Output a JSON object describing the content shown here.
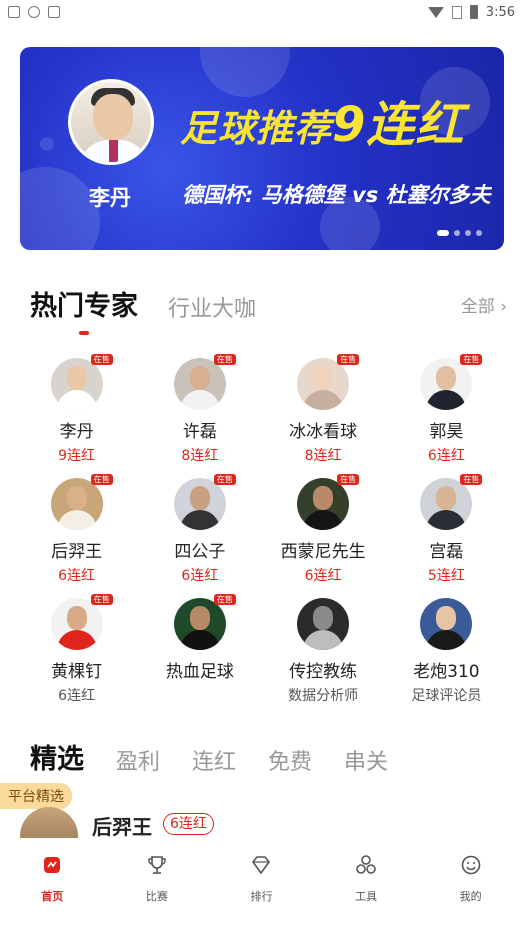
{
  "status_bar": {
    "time": "3:56"
  },
  "banner": {
    "person_name": "李丹",
    "title_prefix": "足球推荐",
    "title_highlight": "9连红",
    "subtitle": "德国杯: 马格德堡 vs 杜塞尔多夫",
    "page_count": 4,
    "active_page": 1
  },
  "hot_section": {
    "tabs": [
      {
        "label": "热门专家",
        "active": true
      },
      {
        "label": "行业大咖",
        "active": false
      }
    ],
    "all_link": "全部 ›",
    "experts": [
      {
        "name": "李丹",
        "sub": "9连红",
        "badge": "在售",
        "sub_color": "red",
        "avatar": {
          "bg": "#d8d3cc",
          "head": "#e9c8a8",
          "body": "#ffffff"
        }
      },
      {
        "name": "许磊",
        "sub": "8连红",
        "badge": "在售",
        "sub_color": "red",
        "avatar": {
          "bg": "#c9c2b8",
          "head": "#d7b090",
          "body": "#f2f2f2"
        }
      },
      {
        "name": "冰冰看球",
        "sub": "8连红",
        "badge": "在售",
        "sub_color": "red",
        "avatar": {
          "bg": "#e8d8cc",
          "head": "#f1d2bd",
          "body": "#c8b0a0"
        }
      },
      {
        "name": "郭昊",
        "sub": "6连红",
        "badge": "在售",
        "sub_color": "red",
        "avatar": {
          "bg": "#f2f2f2",
          "head": "#e2bfa0",
          "body": "#1f2430"
        }
      },
      {
        "name": "后羿王",
        "sub": "6连红",
        "badge": "在售",
        "sub_color": "red",
        "avatar": {
          "bg": "#c9a57a",
          "head": "#d9b088",
          "body": "#f3efe6"
        }
      },
      {
        "name": "四公子",
        "sub": "6连红",
        "badge": "在售",
        "sub_color": "red",
        "avatar": {
          "bg": "#d0d4da",
          "head": "#c9a080",
          "body": "#333333"
        }
      },
      {
        "name": "西蒙尼先生",
        "sub": "6连红",
        "badge": "在售",
        "sub_color": "red",
        "avatar": {
          "bg": "#35402c",
          "head": "#b98a6a",
          "body": "#151515"
        }
      },
      {
        "name": "宫磊",
        "sub": "5连红",
        "badge": "在售",
        "sub_color": "red",
        "avatar": {
          "bg": "#cfd2d6",
          "head": "#d8b494",
          "body": "#2a2d35"
        }
      },
      {
        "name": "黄棵钉",
        "sub": "6连红",
        "badge": "在售",
        "sub_color": "gray",
        "avatar": {
          "bg": "#f2f2f2",
          "head": "#d8aa88",
          "body": "#e0251a"
        }
      },
      {
        "name": "热血足球",
        "sub": "",
        "badge": "在售",
        "sub_color": "gray",
        "avatar": {
          "bg": "#1e4a2a",
          "head": "#b88a68",
          "body": "#111111"
        }
      },
      {
        "name": "传控教练",
        "sub": "数据分析师",
        "badge": "",
        "sub_color": "gray",
        "avatar": {
          "bg": "#2b2b2b",
          "head": "#8a8a8a",
          "body": "#bdbdbd"
        }
      },
      {
        "name": "老炮310",
        "sub": "足球评论员",
        "badge": "",
        "sub_color": "gray",
        "avatar": {
          "bg": "#3a5a9a",
          "head": "#e6c4a4",
          "body": "#1a1a1a"
        }
      }
    ]
  },
  "selected_section": {
    "tabs": [
      {
        "label": "精选",
        "active": true
      },
      {
        "label": "盈利",
        "active": false
      },
      {
        "label": "连红",
        "active": false
      },
      {
        "label": "免费",
        "active": false
      },
      {
        "label": "串关",
        "active": false
      }
    ],
    "card": {
      "platform_tag": "平台精选",
      "name": "后羿王",
      "streak": "6连红"
    }
  },
  "bottom_nav": [
    {
      "label": "首页",
      "icon": "home-chart-icon",
      "active": true
    },
    {
      "label": "比赛",
      "icon": "trophy-icon",
      "active": false
    },
    {
      "label": "排行",
      "icon": "diamond-icon",
      "active": false
    },
    {
      "label": "工具",
      "icon": "tools-icon",
      "active": false
    },
    {
      "label": "我的",
      "icon": "smiley-icon",
      "active": false
    }
  ],
  "colors": {
    "accent": "#e0251a",
    "banner": "#2432c8",
    "banner_title": "#f7e433"
  }
}
